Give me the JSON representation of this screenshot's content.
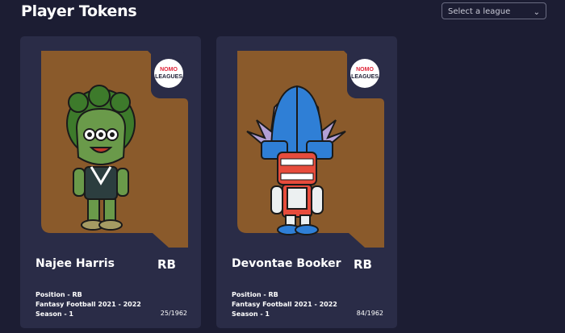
{
  "header": {
    "title": "Player Tokens"
  },
  "league_select": {
    "placeholder": "Select a league",
    "icon": "chevron-down-icon"
  },
  "badge_text": {
    "line1": "NOMO",
    "line2": "LEAGUES"
  },
  "colors": {
    "background": "#1c1d33",
    "card": "#2a2c47",
    "art_bg": "#8a5a2b",
    "art_dark": "#3a3c5a"
  },
  "cards": [
    {
      "name": "Najee Harris",
      "position_badge": "RB",
      "position_line": "Position - RB",
      "league_line": "Fantasy Football 2021 - 2022",
      "season_line": "Season - 1",
      "serial": "25/1962"
    },
    {
      "name": "Devontae Booker",
      "position_badge": "RB",
      "position_line": "Position - RB",
      "league_line": "Fantasy Football 2021 - 2022",
      "season_line": "Season - 1",
      "serial": "84/1962"
    }
  ]
}
